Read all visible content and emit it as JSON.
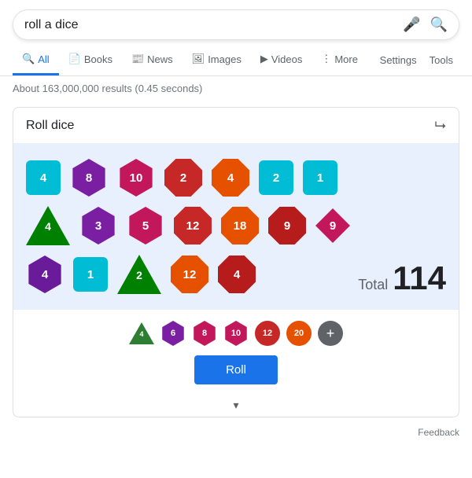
{
  "search": {
    "query": "roll a dice",
    "placeholder": "roll a dice"
  },
  "nav": {
    "tabs": [
      {
        "label": "All",
        "icon": "🔍",
        "active": true
      },
      {
        "label": "Books",
        "icon": "📄"
      },
      {
        "label": "News",
        "icon": "📰"
      },
      {
        "label": "Images",
        "icon": "🖼"
      },
      {
        "label": "Videos",
        "icon": "▶"
      },
      {
        "label": "More",
        "icon": "⋮"
      }
    ],
    "settings": "Settings",
    "tools": "Tools"
  },
  "results_info": "About 163,000,000 results (0.45 seconds)",
  "card": {
    "title": "Roll dice",
    "total_label": "Total",
    "total_value": "114",
    "roll_button": "Roll",
    "expand_label": "▾",
    "feedback": "Feedback"
  },
  "dice": {
    "rows": [
      [
        {
          "shape": "sq",
          "color": "c-teal",
          "value": "4"
        },
        {
          "shape": "hex",
          "color": "c-purple",
          "value": "8"
        },
        {
          "shape": "hex",
          "color": "c-magenta",
          "value": "10"
        },
        {
          "shape": "oct",
          "color": "c-red",
          "value": "2"
        },
        {
          "shape": "oct",
          "color": "c-orange",
          "value": "4"
        },
        {
          "shape": "sq",
          "color": "c-teal",
          "value": "2"
        },
        {
          "shape": "sq",
          "color": "c-teal",
          "value": "1"
        }
      ],
      [
        {
          "shape": "tri",
          "color": "c-green",
          "value": "4"
        },
        {
          "shape": "hex",
          "color": "c-purple",
          "value": "3"
        },
        {
          "shape": "hex",
          "color": "c-magenta",
          "value": "5"
        },
        {
          "shape": "oct",
          "color": "c-red",
          "value": "12"
        },
        {
          "shape": "oct",
          "color": "c-orange",
          "value": "18"
        },
        {
          "shape": "oct",
          "color": "c-dark-red",
          "value": "9"
        },
        {
          "shape": "dia",
          "color": "c-magenta",
          "value": "9"
        }
      ],
      [
        {
          "shape": "hex",
          "color": "c-purple",
          "value": "4"
        },
        {
          "shape": "sq",
          "color": "c-teal",
          "value": "1"
        },
        {
          "shape": "tri",
          "color": "c-green",
          "value": "2"
        },
        {
          "shape": "oct",
          "color": "c-orange",
          "value": "12"
        },
        {
          "shape": "oct",
          "color": "c-dark-red",
          "value": "4"
        }
      ]
    ],
    "selectors": [
      {
        "label": "4",
        "color": "#2e7d32",
        "type": "tri"
      },
      {
        "label": "6",
        "color": "#7b1fa2",
        "type": "hex"
      },
      {
        "label": "8",
        "color": "#c2185b",
        "type": "hex"
      },
      {
        "label": "10",
        "color": "#c2185b",
        "type": "hex"
      },
      {
        "label": "12",
        "color": "#c62828",
        "type": "oct"
      },
      {
        "label": "20",
        "color": "#e65100",
        "type": "oct"
      },
      {
        "label": "+",
        "color": "#5f6368",
        "type": "add"
      }
    ]
  }
}
